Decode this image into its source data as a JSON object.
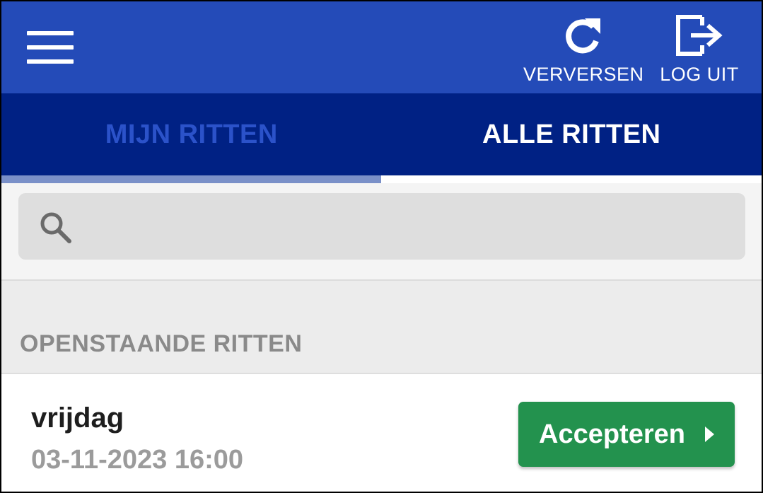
{
  "header": {
    "menu_icon": "hamburger-menu-icon",
    "refresh_label": "VERVERSEN",
    "refresh_icon": "refresh-icon",
    "logout_label": "LOG UIT",
    "logout_icon": "logout-icon",
    "bg_color": "#244bb8"
  },
  "tabs": [
    {
      "label": "MIJN RITTEN",
      "active": true
    },
    {
      "label": "ALLE RITTEN",
      "active": false
    }
  ],
  "search": {
    "placeholder": "",
    "value": "",
    "icon": "search-icon"
  },
  "section": {
    "title": "OPENSTAANDE RITTEN"
  },
  "rides": [
    {
      "day": "vrijdag",
      "datetime": "03-11-2023 16:00",
      "action_label": "Accepteren",
      "action_icon": "play-arrow-icon",
      "action_color": "#23924e"
    }
  ]
}
